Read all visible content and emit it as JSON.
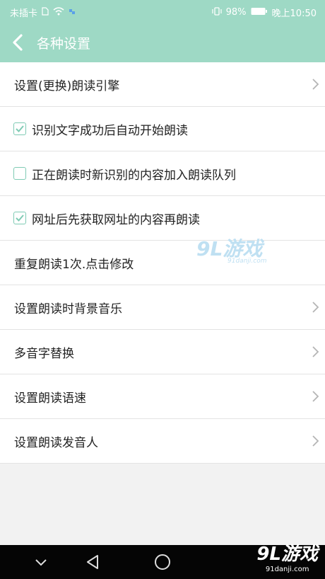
{
  "status_bar": {
    "carrier": "未插卡",
    "battery": "98%",
    "time": "晚上10:50"
  },
  "app_bar": {
    "title": "各种设置",
    "back_icon": "chevron-left-icon"
  },
  "settings": [
    {
      "label": "设置(更换)朗读引擎",
      "type": "nav"
    },
    {
      "label": "识别文字成功后自动开始朗读",
      "type": "checkbox",
      "checked": true
    },
    {
      "label": "正在朗读时新识别的内容加入朗读队列",
      "type": "checkbox",
      "checked": false
    },
    {
      "label": "网址后先获取网址的内容再朗读",
      "type": "checkbox",
      "checked": true
    },
    {
      "label": "重复朗读1次.点击修改",
      "type": "plain"
    },
    {
      "label": "设置朗读时背景音乐",
      "type": "nav"
    },
    {
      "label": "多音字替换",
      "type": "nav"
    },
    {
      "label": "设置朗读语速",
      "type": "nav"
    },
    {
      "label": "设置朗读发音人",
      "type": "nav"
    }
  ],
  "watermark": {
    "brand": "9L游戏",
    "domain": "91danji.com"
  },
  "corner_logo": {
    "brand": "9L游戏",
    "domain": "91danji.com"
  },
  "colors": {
    "accent": "#9ed9c5",
    "checkbox": "#7fcbb4",
    "navbar": "#050505"
  }
}
